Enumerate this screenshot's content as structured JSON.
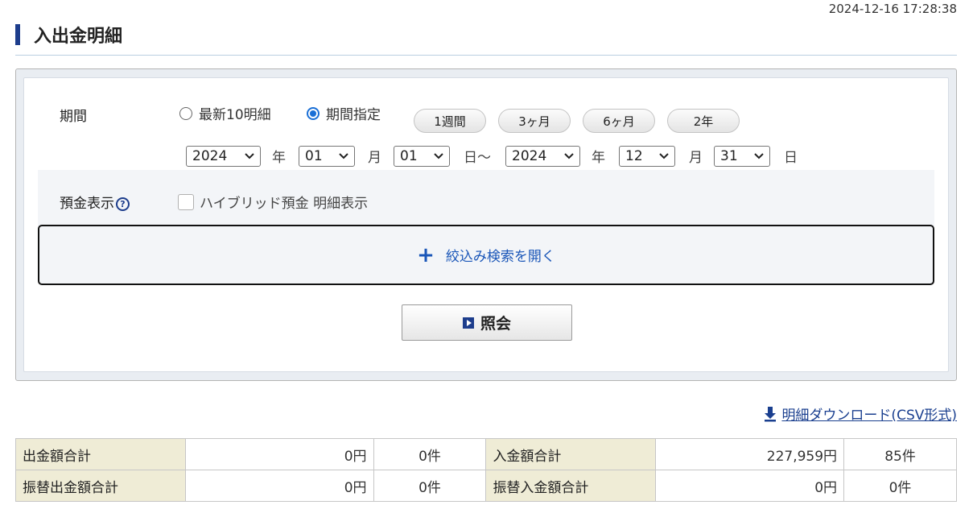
{
  "timestamp": "2024-12-16 17:28:38",
  "page_title": "入出金明細",
  "search": {
    "period_label": "期間",
    "radio_latest": "最新10明細",
    "radio_range": "期間指定",
    "radio_selected": "期間指定",
    "quick_ranges": [
      "1週間",
      "3ヶ月",
      "6ヶ月",
      "2年"
    ],
    "from_year": "2024",
    "from_month": "01",
    "from_day": "01",
    "to_year": "2024",
    "to_month": "12",
    "to_day": "31",
    "unit_year": "年",
    "unit_month": "月",
    "unit_day_tilde": "日〜",
    "unit_day": "日",
    "deposit_label": "預金表示",
    "help_mark": "?",
    "hybrid_checkbox_label": "ハイブリッド預金 明細表示",
    "hybrid_checked": false,
    "filter_toggle_label": "絞込み検索を開く",
    "query_button": "照会"
  },
  "download_link": "明細ダウンロード(CSV形式)",
  "summary": {
    "rows": [
      {
        "left_label": "出金額合計",
        "left_amount": "0円",
        "left_count": "0件",
        "right_label": "入金額合計",
        "right_amount": "227,959円",
        "right_count": "85件"
      },
      {
        "left_label": "振替出金額合計",
        "left_amount": "0円",
        "left_count": "0件",
        "right_label": "振替入金額合計",
        "right_amount": "0円",
        "right_count": "0件"
      }
    ]
  },
  "colors": {
    "accent": "#1d3d8c",
    "link": "#1a56b8",
    "header_cell_bg": "#efecd6",
    "radio_selected": "#1a6fd6"
  }
}
